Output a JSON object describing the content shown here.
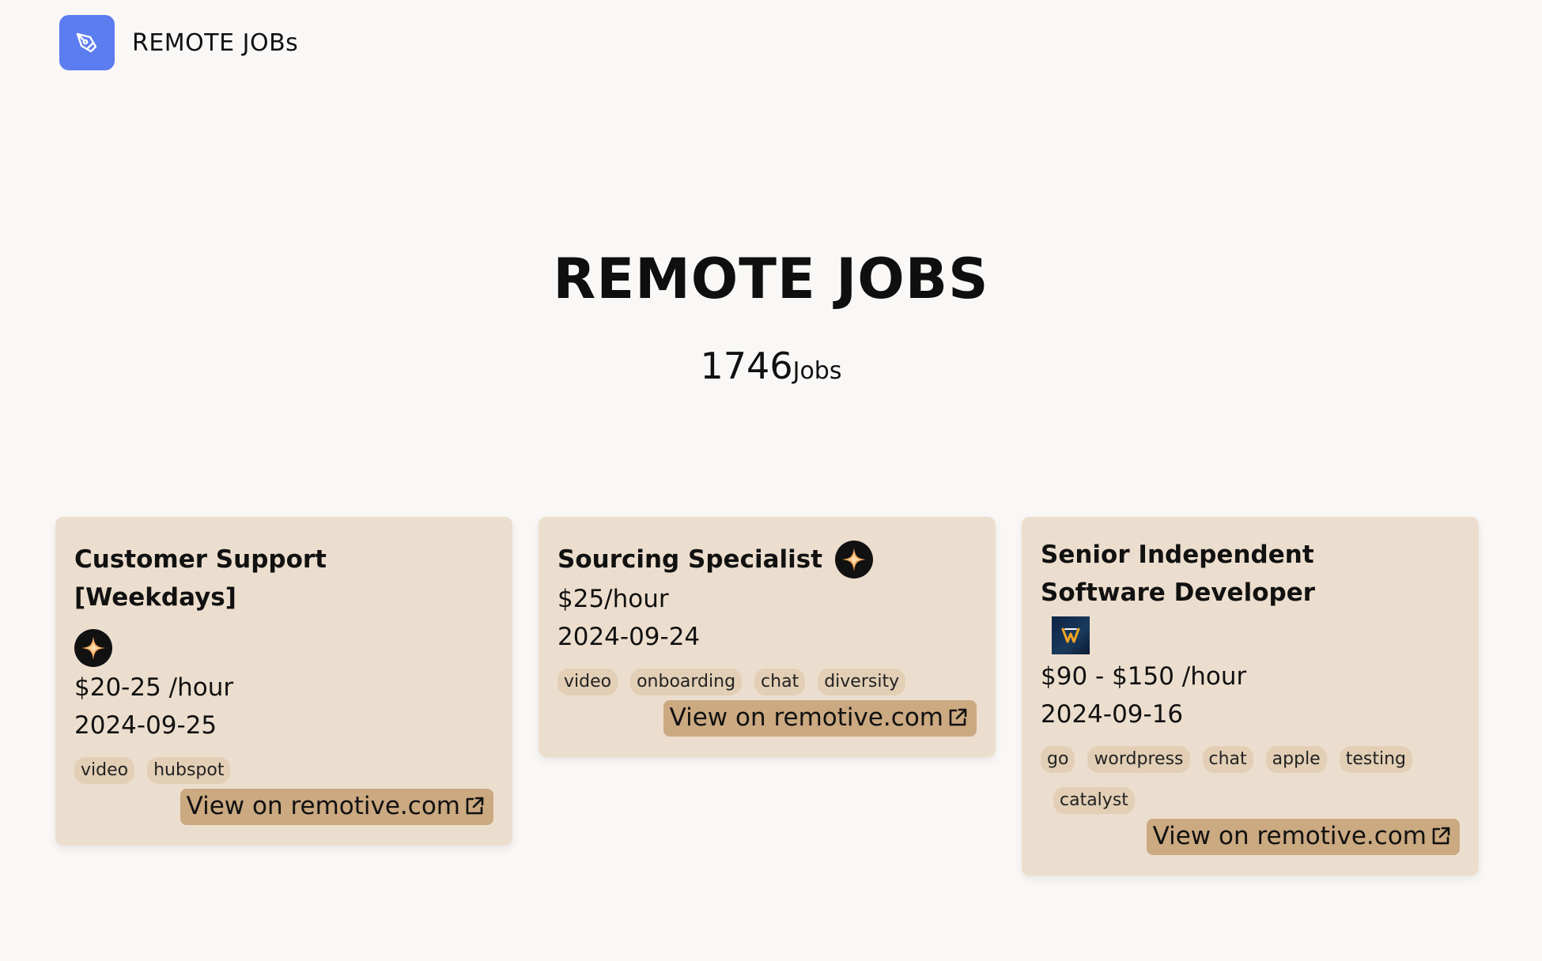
{
  "header": {
    "brand": "REMOTE JOBs",
    "logo_color": "#5b7df0",
    "logo_icon": "pen-nib-icon"
  },
  "hero": {
    "title": "REMOTE JOBS",
    "count": "1746",
    "count_unit": "Jobs"
  },
  "jobs": [
    {
      "title": "Customer Support [Weekdays]",
      "company_icon": "sparkle-star-logo",
      "salary": "$20-25 /hour",
      "date": "2024-09-25",
      "tags": [
        "video",
        "hubspot"
      ],
      "view_label": "View on remotive.com"
    },
    {
      "title": "Sourcing Specialist",
      "company_icon": "sparkle-star-logo",
      "salary": "$25/hour",
      "date": "2024-09-24",
      "tags": [
        "video",
        "onboarding",
        "chat",
        "diversity"
      ],
      "view_label": "View on remotive.com"
    },
    {
      "title": "Senior Independent Software Developer",
      "company_icon": "square-brand-logo",
      "salary": "$90 - $150 /hour",
      "date": "2024-09-16",
      "tags": [
        "go",
        "wordpress",
        "chat",
        "apple",
        "testing",
        "catalyst"
      ],
      "view_label": "View on remotive.com"
    }
  ],
  "colors": {
    "background": "#faf8f6",
    "card": "#ecdece",
    "tag": "#e2cfb6",
    "button": "#cba981"
  }
}
